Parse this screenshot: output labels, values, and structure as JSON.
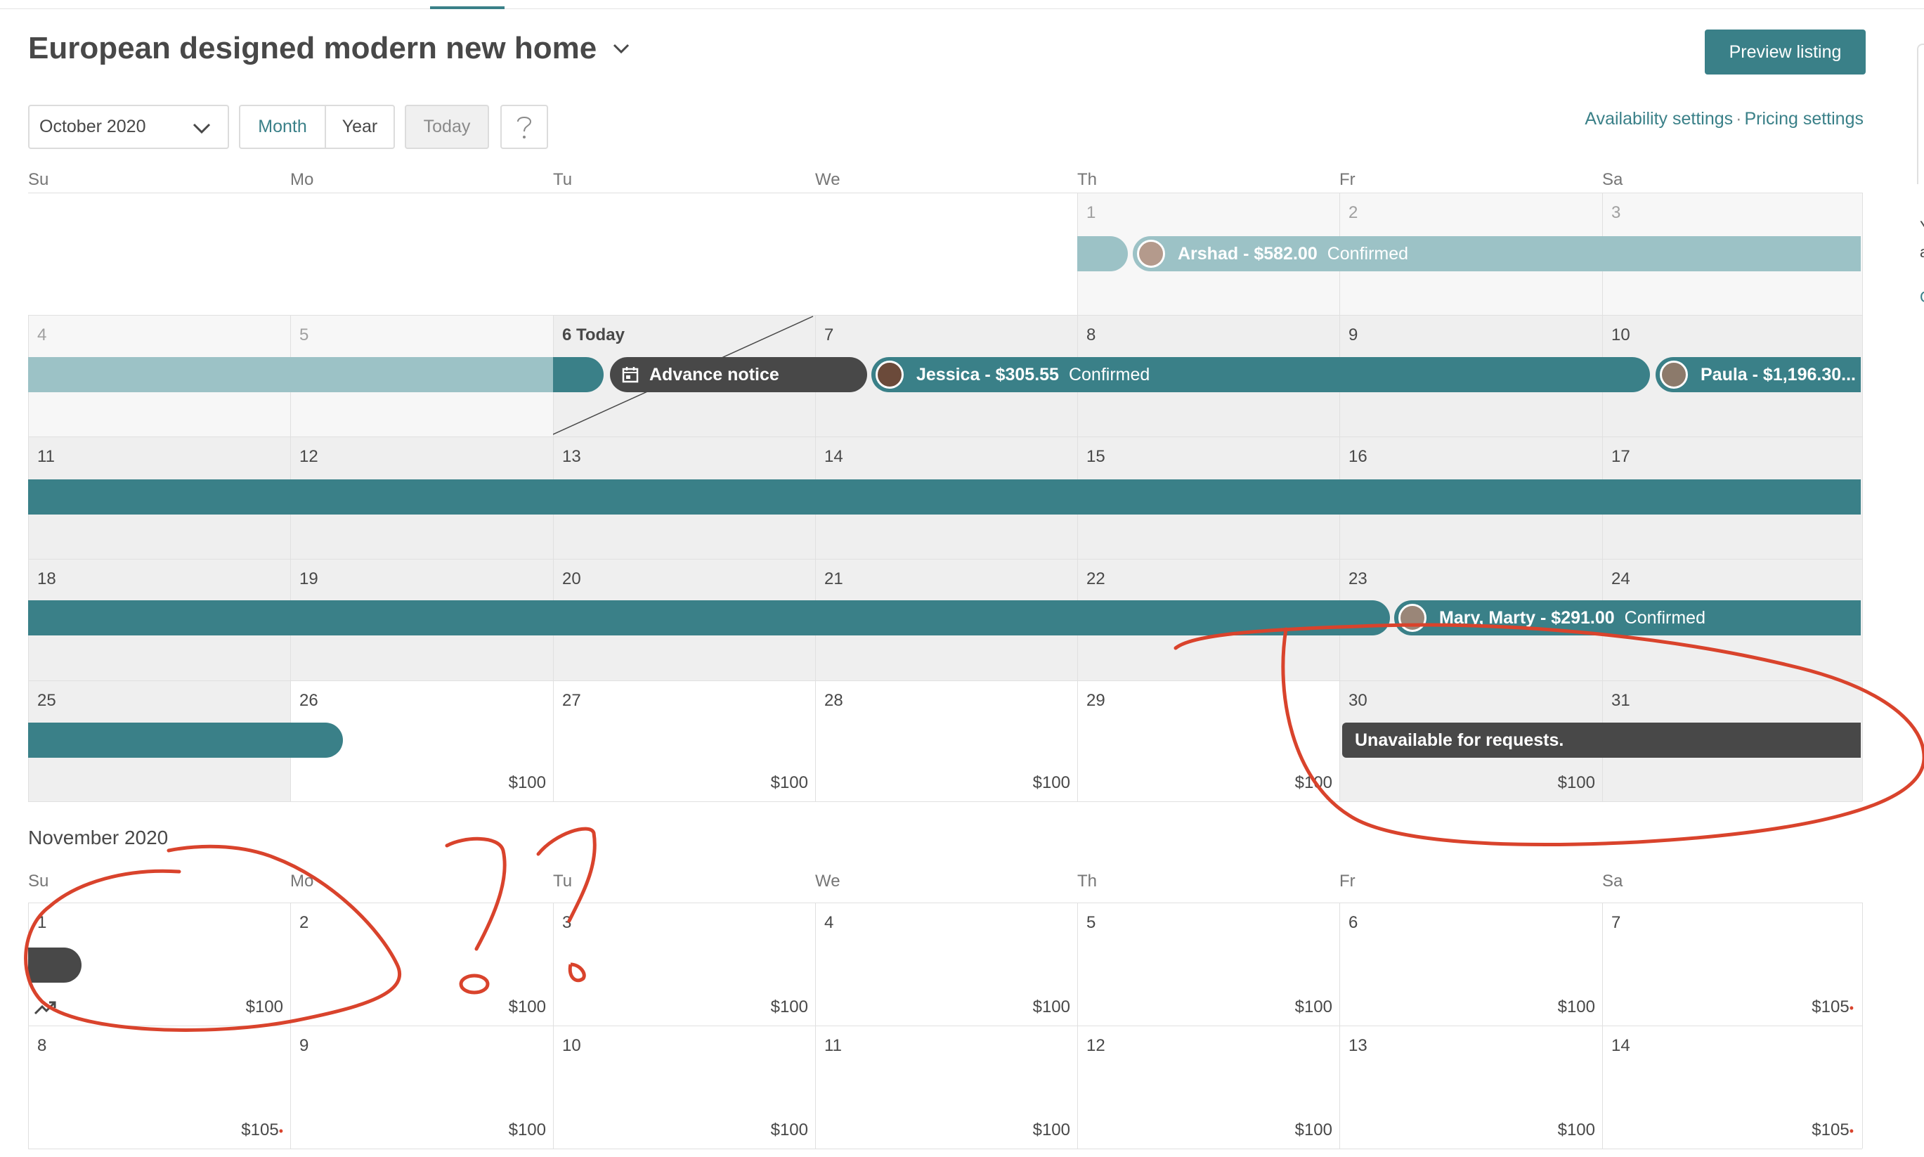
{
  "header": {
    "title": "European designed modern new home",
    "preview_label": "Preview listing"
  },
  "toolbar": {
    "month_value": "October 2020",
    "month_label": "Month",
    "year_label": "Year",
    "today_label": "Today",
    "help_label": "?",
    "availability_label": "Availability settings",
    "separator": "·",
    "pricing_label": "Pricing settings"
  },
  "weekdays": [
    "Su",
    "Mo",
    "Tu",
    "We",
    "Th",
    "Fr",
    "Sa"
  ],
  "october": {
    "days": {
      "d1": "1",
      "d2": "2",
      "d3": "3",
      "d4": "4",
      "d5": "5",
      "d6": "6 Today",
      "d7": "7",
      "d8": "8",
      "d9": "9",
      "d10": "10",
      "d11": "11",
      "d12": "12",
      "d13": "13",
      "d14": "14",
      "d15": "15",
      "d16": "16",
      "d17": "17",
      "d18": "18",
      "d19": "19",
      "d20": "20",
      "d21": "21",
      "d22": "22",
      "d23": "23",
      "d24": "24",
      "d25": "25",
      "d26": "26",
      "d27": "27",
      "d28": "28",
      "d29": "29",
      "d30": "30",
      "d31": "31"
    },
    "prices": {
      "d26": "$100",
      "d27": "$100",
      "d28": "$100",
      "d29": "$100",
      "d30": "$100"
    },
    "reservations": {
      "arshad": {
        "name": "Arshad - $582.00",
        "status": "Confirmed"
      },
      "advance": {
        "label": "Advance notice"
      },
      "jessica": {
        "name": "Jessica - $305.55",
        "status": "Confirmed"
      },
      "paula": {
        "name": "Paula - $1,196.30..."
      },
      "mary": {
        "name": "Mary, Marty - $291.00",
        "status": "Confirmed"
      },
      "unavailable": {
        "label": "Unavailable for requests."
      }
    }
  },
  "november": {
    "title": "November 2020",
    "days": {
      "d1": "1",
      "d2": "2",
      "d3": "3",
      "d4": "4",
      "d5": "5",
      "d6": "6",
      "d7": "7",
      "d8": "8",
      "d9": "9",
      "d10": "10",
      "d11": "11",
      "d12": "12",
      "d13": "13",
      "d14": "14"
    },
    "prices": {
      "d1": "$100",
      "d2": "$100",
      "d3": "$100",
      "d4": "$100",
      "d5": "$100",
      "d6": "$100",
      "d7": "$105",
      "d8": "$105",
      "d9": "$100",
      "d10": "$100",
      "d11": "$100",
      "d12": "$100",
      "d13": "$100",
      "d14": "$105"
    },
    "price_marker": "•"
  },
  "sidebar_edge": {
    "glyph_a": "Y",
    "glyph_b": "a",
    "glyph_c": "C"
  },
  "colors": {
    "accent": "#3a8088",
    "light_booking": "#9cc2c6",
    "charcoal": "#484848",
    "annotation_red": "#d9432c"
  }
}
